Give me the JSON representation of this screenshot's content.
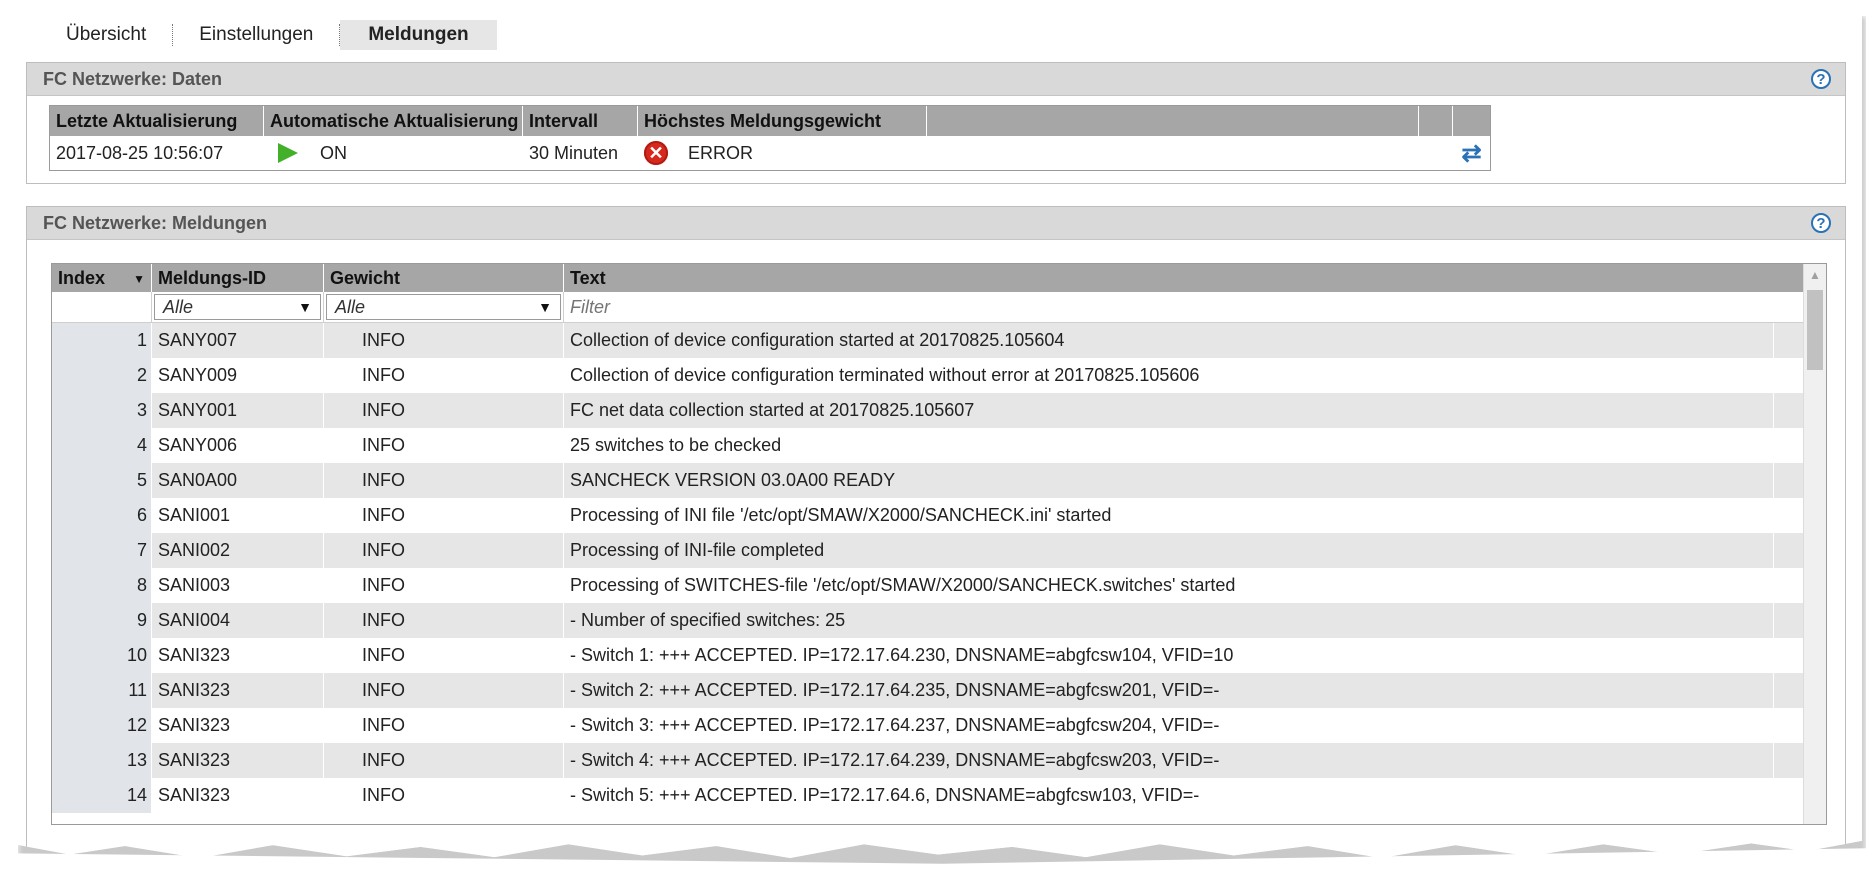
{
  "tabs": [
    "Übersicht",
    "Einstellungen",
    "Meldungen"
  ],
  "panel_data": {
    "title": "FC Netzwerke: Daten",
    "columns": [
      "Letzte Aktualisierung",
      "Automatische Aktualisierung",
      "Intervall",
      "Höchstes Meldungsgewicht"
    ],
    "row": {
      "last_update": "2017-08-25   10:56:07",
      "auto_update": "ON",
      "interval": "30 Minuten",
      "severity": "ERROR"
    }
  },
  "panel_messages": {
    "title": "FC Netzwerke: Meldungen",
    "columns": [
      "Index",
      "Meldungs-ID",
      "Gewicht",
      "Text"
    ],
    "filters": {
      "id": "Alle",
      "weight": "Alle",
      "text_placeholder": "Filter"
    },
    "rows": [
      {
        "index": "1",
        "id": "SANY007",
        "weight": "INFO",
        "text": "Collection of device configuration started at 20170825.105604"
      },
      {
        "index": "2",
        "id": "SANY009",
        "weight": "INFO",
        "text": "Collection of device configuration terminated without error at 20170825.105606"
      },
      {
        "index": "3",
        "id": "SANY001",
        "weight": "INFO",
        "text": "FC net data collection started at 20170825.105607"
      },
      {
        "index": "4",
        "id": "SANY006",
        "weight": "INFO",
        "text": "25 switches to be checked"
      },
      {
        "index": "5",
        "id": "SAN0A00",
        "weight": "INFO",
        "text": "SANCHECK VERSION 03.0A00 READY"
      },
      {
        "index": "6",
        "id": "SANI001",
        "weight": "INFO",
        "text": "Processing of INI file '/etc/opt/SMAW/X2000/SANCHECK.ini' started"
      },
      {
        "index": "7",
        "id": "SANI002",
        "weight": "INFO",
        "text": "Processing of INI-file completed"
      },
      {
        "index": "8",
        "id": "SANI003",
        "weight": "INFO",
        "text": "Processing of SWITCHES-file '/etc/opt/SMAW/X2000/SANCHECK.switches' started"
      },
      {
        "index": "9",
        "id": "SANI004",
        "weight": "INFO",
        "text": "- Number of specified switches: 25"
      },
      {
        "index": "10",
        "id": "SANI323",
        "weight": "INFO",
        "text": "- Switch 1: +++ ACCEPTED. IP=172.17.64.230, DNSNAME=abgfcsw104, VFID=10"
      },
      {
        "index": "11",
        "id": "SANI323",
        "weight": "INFO",
        "text": "- Switch 2: +++ ACCEPTED. IP=172.17.64.235, DNSNAME=abgfcsw201, VFID=-"
      },
      {
        "index": "12",
        "id": "SANI323",
        "weight": "INFO",
        "text": "- Switch 3: +++ ACCEPTED. IP=172.17.64.237, DNSNAME=abgfcsw204, VFID=-"
      },
      {
        "index": "13",
        "id": "SANI323",
        "weight": "INFO",
        "text": "- Switch 4: +++ ACCEPTED. IP=172.17.64.239, DNSNAME=abgfcsw203, VFID=-"
      },
      {
        "index": "14",
        "id": "SANI323",
        "weight": "INFO",
        "text": "- Switch 5: +++ ACCEPTED. IP=172.17.64.6, DNSNAME=abgfcsw103, VFID=-"
      }
    ]
  },
  "icons": {
    "help": "?",
    "play": "play-icon",
    "error": "✕",
    "refresh": "⇄",
    "sort": "▼",
    "dropdown": "▼",
    "scroll_up": "▲"
  },
  "colors": {
    "header_bg": "#a6a6a6",
    "panel_header": "#d9d9d9",
    "on_green": "#43b02a",
    "error_red": "#d7281e",
    "link_blue": "#2a72b5"
  }
}
